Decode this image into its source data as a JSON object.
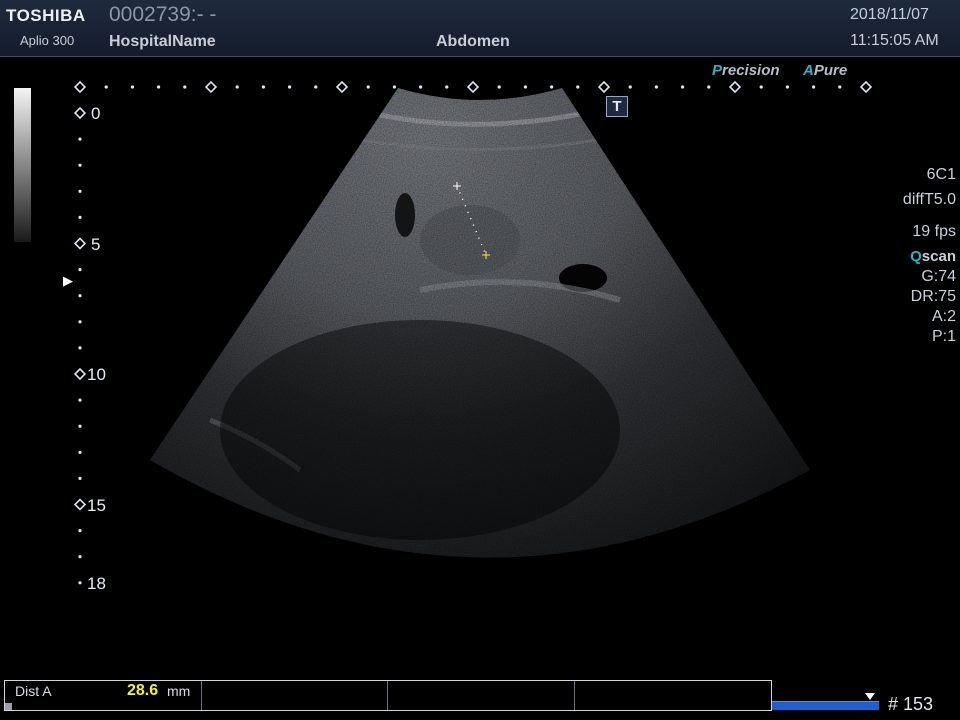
{
  "header": {
    "brand": "TOSHIBA",
    "model": "Aplio 300",
    "patient_id": "0002739:- -",
    "hospital": "HospitalName",
    "exam": "Abdomen",
    "date": "2018/11/07",
    "time": "11:15:05 AM"
  },
  "modes": {
    "precision_initial": "P",
    "precision_rest": "recision",
    "apure_initial": "A",
    "apure_rest": "Pure"
  },
  "params": {
    "probe": "6C1",
    "preset": "diffT5.0",
    "fps": "19 fps",
    "qscan_initial": "Q",
    "qscan_rest": "scan",
    "gain": "G:74",
    "dr": "DR:75",
    "acq": "A:2",
    "persistence": "P:1"
  },
  "depth_scale": [
    "0",
    "5",
    "10",
    "15",
    "18"
  ],
  "t_badge": "T",
  "measurement": {
    "label": "Dist A",
    "value": "28.6",
    "unit": "mm"
  },
  "frame": "# 153",
  "colors": {
    "caliper": "#f4f22c",
    "cine_bar": "#2060c8",
    "accent": "#2bb3c3"
  }
}
